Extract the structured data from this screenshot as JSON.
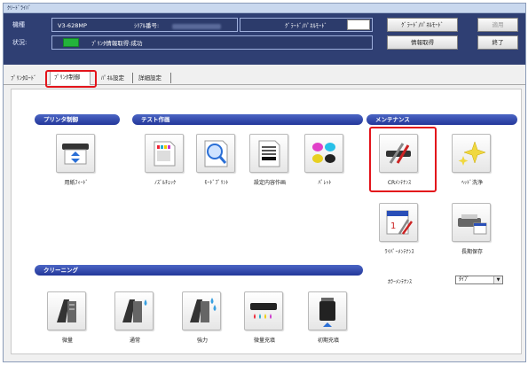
{
  "window": {
    "title": "ｸﾘｰﾄﾞﾗｲﾊﾞ"
  },
  "info": {
    "model_label": "機種",
    "model_value": "V3-628MP",
    "serial_label": "ｼﾘｱﾙ番号:",
    "mode_label": "ｸﾞﾗｰﾄﾞ/ﾊﾟﾈﾙﾓｰﾄﾞ",
    "status_label": "状況:",
    "status_value": "ﾌﾟﾘﾝﾀ情報取得:成功",
    "status_color": "#23b33b",
    "btn_mode": "ｸﾞﾗｰﾄﾞ/ﾊﾟﾈﾙﾓｰﾄﾞ",
    "btn_apply": "適用",
    "btn_get_info": "情報取得",
    "btn_exit": "終了"
  },
  "tabs": [
    "ﾌﾟﾘﾝﾀﾛｰﾄﾞ",
    "ﾌﾟﾘﾝﾀ制御",
    "ﾊﾟﾈﾙ設定",
    "詳細設定"
  ],
  "sections": {
    "printer_control": "プリンタ制御",
    "test_print": "テスト作画",
    "maintenance": "メンテナンス",
    "cleaning": "クリーニング"
  },
  "tiles": {
    "paper_feed": "用紙ﾌｨｰﾄﾞ",
    "nozzle_check": "ﾉｽﾞﾙﾁｪｯｸ",
    "mode_print": "ﾓｰﾄﾞﾌﾟﾘﾝﾄ",
    "settings_print": "設定内容作画",
    "palette": "ﾊﾟﾚｯﾄ",
    "cr_maintenance": "CRﾒﾝﾃﾅﾝｽ",
    "head_wash": "ﾍｯﾄﾞ洗浄",
    "wiper_maintenance": "ﾜｲﾊﾟｰﾒﾝﾃﾅﾝｽ",
    "long_storage": "長期保存",
    "clean_light": "微量",
    "clean_normal": "通常",
    "clean_strong": "強力",
    "ink_fill": "微量充填",
    "initial_fill": "初期充填"
  },
  "color_maint": {
    "label": "ｶﾗｰﾒﾝﾃﾅﾝｽ",
    "value": "ﾀｲﾌﾟ"
  }
}
